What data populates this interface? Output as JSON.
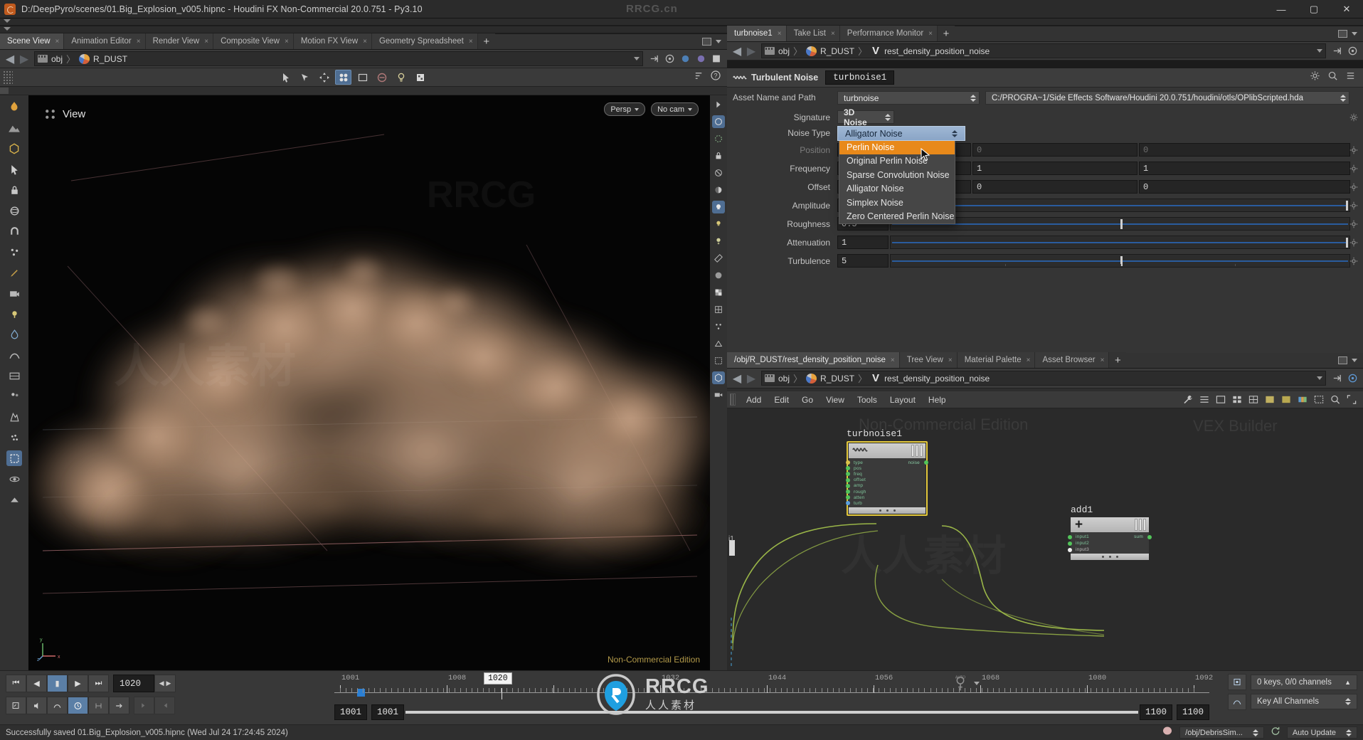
{
  "window": {
    "title": "D:/DeepPyro/scenes/01.Big_Explosion_v005.hipnc - Houdini FX Non-Commercial 20.0.751 - Py3.10",
    "watermark": "RRCG.cn",
    "minimize": "—",
    "maximize": "▢",
    "close": "✕"
  },
  "left_tabs": [
    {
      "label": "Scene View",
      "close": "×",
      "active": true
    },
    {
      "label": "Animation Editor",
      "close": "×",
      "active": false
    },
    {
      "label": "Render View",
      "close": "×",
      "active": false
    },
    {
      "label": "Composite View",
      "close": "×",
      "active": false
    },
    {
      "label": "Motion FX View",
      "close": "×",
      "active": false
    },
    {
      "label": "Geometry Spreadsheet",
      "close": "×",
      "active": false
    }
  ],
  "left_tabs_plus": "+",
  "left_path": {
    "back": "◀",
    "forward": "▶",
    "crumbs": [
      "obj",
      "R_DUST"
    ],
    "separator": "〉"
  },
  "viewport": {
    "label": "View",
    "persp": "Persp",
    "camera": "No cam",
    "watermark_edition": "Non-Commercial Edition",
    "axis_labels": [
      "y",
      "z",
      "x"
    ]
  },
  "param_panel": {
    "tabs": [
      {
        "label": "turbnoise1",
        "close": "×",
        "active": true
      },
      {
        "label": "Take List",
        "close": "×",
        "active": false
      },
      {
        "label": "Performance Monitor",
        "close": "×",
        "active": false
      }
    ],
    "tabs_plus": "+",
    "path": {
      "crumbs": [
        "obj",
        "R_DUST",
        "rest_density_position_noise"
      ]
    },
    "header": {
      "title": "Turbulent Noise",
      "node_name": "turbnoise1"
    },
    "asset": {
      "label": "Asset Name and Path",
      "name": "turbnoise",
      "path": "C:/PROGRA~1/Side Effects Software/Houdini 20.0.751/houdini/otls/OPlibScripted.hda"
    },
    "rows": [
      {
        "label": "Signature",
        "type": "combo",
        "value": "3D Noise"
      },
      {
        "label": "Noise Type",
        "type": "combo-open",
        "value": "Alligator Noise"
      },
      {
        "label": "Position",
        "type": "vec3",
        "dim": true,
        "values": [
          "0",
          "0",
          "0"
        ]
      },
      {
        "label": "Frequency",
        "type": "vec3",
        "values": [
          "1",
          "1",
          "1"
        ]
      },
      {
        "label": "Offset",
        "type": "vec3",
        "values": [
          "0",
          "0",
          "0"
        ]
      },
      {
        "label": "Amplitude",
        "type": "slider",
        "value": "1",
        "fill": 1.0
      },
      {
        "label": "Roughness",
        "type": "slider",
        "value": "0.5",
        "fill": 0.5
      },
      {
        "label": "Attenuation",
        "type": "slider",
        "value": "1",
        "fill": 1.0
      },
      {
        "label": "Turbulence",
        "type": "slider",
        "value": "5",
        "fill": 0.5
      }
    ],
    "dropdown": {
      "current": "Alligator Noise",
      "items": [
        {
          "label": "Perlin Noise",
          "highlight": true
        },
        {
          "label": "Original Perlin Noise",
          "highlight": false
        },
        {
          "label": "Sparse Convolution Noise",
          "highlight": false
        },
        {
          "label": "Alligator Noise",
          "highlight": false
        },
        {
          "label": "Simplex Noise",
          "highlight": false
        },
        {
          "label": "Zero Centered Perlin Noise",
          "highlight": false
        }
      ]
    }
  },
  "network": {
    "tabs": [
      {
        "label": "/obj/R_DUST/rest_density_position_noise",
        "close": "×",
        "active": true
      },
      {
        "label": "Tree View",
        "close": "×",
        "active": false
      },
      {
        "label": "Material Palette",
        "close": "×",
        "active": false
      },
      {
        "label": "Asset Browser",
        "close": "×",
        "active": false
      }
    ],
    "tabs_plus": "+",
    "path": {
      "crumbs": [
        "obj",
        "R_DUST",
        "rest_density_position_noise"
      ]
    },
    "menu": [
      "Add",
      "Edit",
      "Go",
      "View",
      "Tools",
      "Layout",
      "Help"
    ],
    "watermarks": [
      "Non-Commercial Edition",
      "VEX Builder"
    ],
    "input_label": "i1",
    "nodes": [
      {
        "name": "turbnoise1",
        "selected": true,
        "inputs": [
          "type",
          "pos",
          "freq",
          "offset",
          "amp",
          "rough",
          "atten",
          "turb"
        ],
        "outputs": [
          "noise"
        ]
      },
      {
        "name": "add1",
        "selected": false,
        "inputs": [
          "input1",
          "input2",
          "input3"
        ],
        "outputs": [
          "sum"
        ]
      }
    ]
  },
  "timeline": {
    "buttons": [
      "⏮",
      "◀",
      "▮",
      "▶",
      "⏭"
    ],
    "current_frame": "1020",
    "playhead_label": "1020",
    "ticks": [
      {
        "label": "1001"
      },
      {
        "label": "1008"
      },
      {
        "label": "1020"
      },
      {
        "label": "1032"
      },
      {
        "label": "1044"
      },
      {
        "label": "1056"
      },
      {
        "label": "1068"
      },
      {
        "label": "1080"
      },
      {
        "label": "1092"
      }
    ],
    "range_start": "1001",
    "range_start2": "1001",
    "range_end": "1100",
    "range_end2": "1100",
    "keys_info": "0 keys, 0/0 channels",
    "key_mode": "Key All Channels"
  },
  "status": {
    "message": "Successfully saved 01.Big_Explosion_v005.hipnc (Wed Jul 24 17:24:45 2024)",
    "node_path": "/obj/DebrisSim...",
    "update_mode": "Auto Update"
  },
  "colors": {
    "accent_orange": "#e8891a",
    "selected_node": "#e3c83c",
    "slider_blue": "#2a5c9e",
    "wire_green": "#9ab648",
    "noncom_gold": "#b39a4a"
  }
}
